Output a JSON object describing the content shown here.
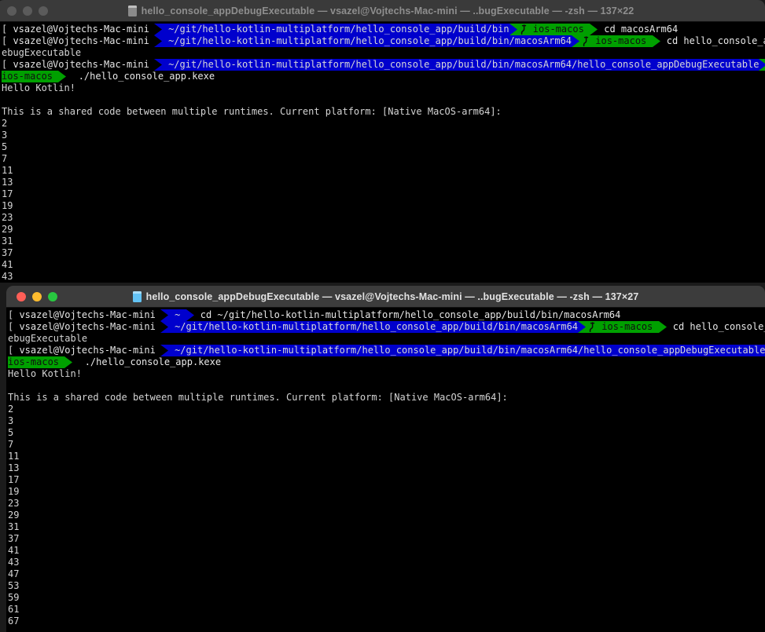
{
  "colors": {
    "terminal_bg": "#000000",
    "path_segment": "#0000cd",
    "git_segment": "#00a000",
    "titlebar_active": "#3c3c3c",
    "titlebar_inactive": "#3a3a3a",
    "close": "#ff5f57",
    "minimize": "#febc2e",
    "maximize": "#28c840",
    "text": "#d6d6d6"
  },
  "windows": [
    {
      "id": "window-back",
      "active": false,
      "title": "hello_console_appDebugExecutable — vsazel@Vojtechs-Mac-mini — ..bugExecutable — -zsh — 137×22",
      "icon": "document-icon",
      "traffic_lights": [
        "close-button",
        "minimize-button",
        "maximize-button"
      ],
      "prompt": {
        "open_bracket": "[",
        "close_bracket": "]",
        "host": "vsazel@Vojtechs-Mac-mini",
        "git_icon": "git-branch-icon",
        "git_branch": "ios-macos"
      },
      "lines": [
        {
          "type": "prompt",
          "path": "~/git/hello-kotlin-multiplatform/hello_console_app/build/bin",
          "branch": "ios-macos",
          "command": "cd macosArm64"
        },
        {
          "type": "prompt",
          "path": "~/git/hello-kotlin-multiplatform/hello_console_app/build/bin/macosArm64",
          "branch": "ios-macos",
          "command": "cd hello_console_appD"
        },
        {
          "type": "text",
          "text": "ebugExecutable"
        },
        {
          "type": "prompt-wrap",
          "path": "~/git/hello-kotlin-multiplatform/hello_console_app/build/bin/macosArm64/hello_console_appDebugExecutable",
          "branch": "ios-macos",
          "command": "./hello_console_app.kexe"
        },
        {
          "type": "text",
          "text": "Hello Kotlin!"
        },
        {
          "type": "text",
          "text": ""
        },
        {
          "type": "text",
          "text": "This is a shared code between multiple runtimes. Current platform: [Native MacOS-arm64]:"
        },
        {
          "type": "text",
          "text": "2"
        },
        {
          "type": "text",
          "text": "3"
        },
        {
          "type": "text",
          "text": "5"
        },
        {
          "type": "text",
          "text": "7"
        },
        {
          "type": "text",
          "text": "11"
        },
        {
          "type": "text",
          "text": "13"
        },
        {
          "type": "text",
          "text": "17"
        },
        {
          "type": "text",
          "text": "19"
        },
        {
          "type": "text",
          "text": "23"
        },
        {
          "type": "text",
          "text": "29"
        },
        {
          "type": "text",
          "text": "31"
        },
        {
          "type": "text",
          "text": "37"
        },
        {
          "type": "text",
          "text": "41"
        },
        {
          "type": "text",
          "text": "43"
        }
      ]
    },
    {
      "id": "window-front",
      "active": true,
      "title": "hello_console_appDebugExecutable — vsazel@Vojtechs-Mac-mini — ..bugExecutable — -zsh — 137×27",
      "icon": "document-icon",
      "traffic_lights": [
        "close-button",
        "minimize-button",
        "maximize-button"
      ],
      "prompt": {
        "open_bracket": "[",
        "close_bracket": "]",
        "host": "vsazel@Vojtechs-Mac-mini",
        "git_icon": "git-branch-icon",
        "git_branch": "ios-macos"
      },
      "lines": [
        {
          "type": "prompt-home",
          "path": "~",
          "command": "cd ~/git/hello-kotlin-multiplatform/hello_console_app/build/bin/macosArm64"
        },
        {
          "type": "prompt",
          "path": "~/git/hello-kotlin-multiplatform/hello_console_app/build/bin/macosArm64",
          "branch": "ios-macos",
          "command": "cd hello_console_appD"
        },
        {
          "type": "text",
          "text": "ebugExecutable"
        },
        {
          "type": "prompt-wrap",
          "path": "~/git/hello-kotlin-multiplatform/hello_console_app/build/bin/macosArm64/hello_console_appDebugExecutable",
          "branch": "ios-macos",
          "command": "./hello_console_app.kexe"
        },
        {
          "type": "text",
          "text": "Hello Kotlin!"
        },
        {
          "type": "text",
          "text": ""
        },
        {
          "type": "text",
          "text": "This is a shared code between multiple runtimes. Current platform: [Native MacOS-arm64]:"
        },
        {
          "type": "text",
          "text": "2"
        },
        {
          "type": "text",
          "text": "3"
        },
        {
          "type": "text",
          "text": "5"
        },
        {
          "type": "text",
          "text": "7"
        },
        {
          "type": "text",
          "text": "11"
        },
        {
          "type": "text",
          "text": "13"
        },
        {
          "type": "text",
          "text": "17"
        },
        {
          "type": "text",
          "text": "19"
        },
        {
          "type": "text",
          "text": "23"
        },
        {
          "type": "text",
          "text": "29"
        },
        {
          "type": "text",
          "text": "31"
        },
        {
          "type": "text",
          "text": "37"
        },
        {
          "type": "text",
          "text": "41"
        },
        {
          "type": "text",
          "text": "43"
        },
        {
          "type": "text",
          "text": "47"
        },
        {
          "type": "text",
          "text": "53"
        },
        {
          "type": "text",
          "text": "59"
        },
        {
          "type": "text",
          "text": "61"
        },
        {
          "type": "text",
          "text": "67"
        }
      ]
    }
  ]
}
